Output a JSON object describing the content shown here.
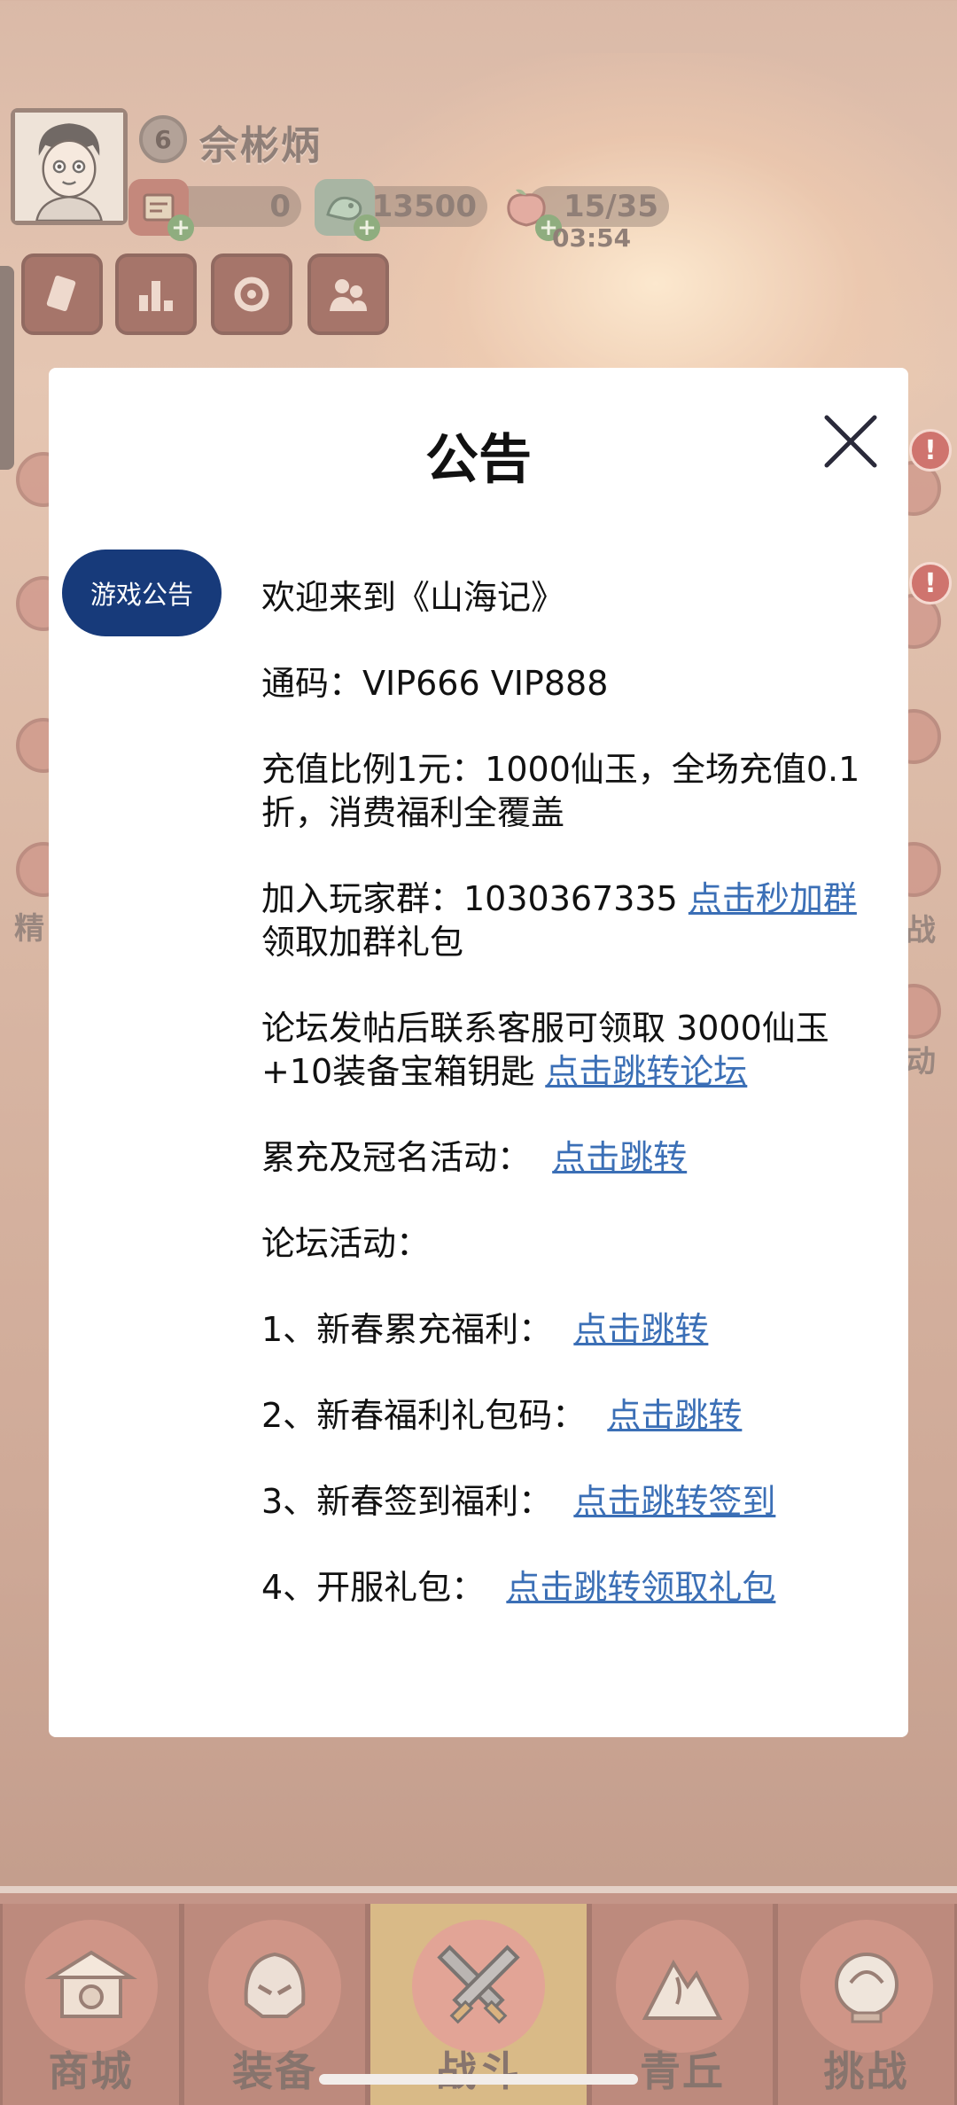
{
  "hud": {
    "level": "6",
    "player_name": "佘彬炳",
    "resources": [
      {
        "icon": "ticket-icon",
        "value": "0"
      },
      {
        "icon": "jade-dragon-icon",
        "value": "13500"
      },
      {
        "icon": "peach-icon",
        "value": "15/35"
      }
    ],
    "stamina_timer": "03:54"
  },
  "side_labels": {
    "left": "精",
    "right_1": "战",
    "right_2": "动"
  },
  "bottom_nav": [
    {
      "label": "商城",
      "icon": "shop-icon",
      "active": false
    },
    {
      "label": "装备",
      "icon": "helmet-icon",
      "active": false
    },
    {
      "label": "战斗",
      "icon": "crossed-swords-icon",
      "active": true
    },
    {
      "label": "青丘",
      "icon": "mountain-icon",
      "active": false
    },
    {
      "label": "挑战",
      "icon": "orb-icon",
      "active": false
    }
  ],
  "dialog": {
    "title": "公告",
    "tab": "游戏公告",
    "welcome": "欢迎来到《山海记》",
    "code": "通码：VIP666 VIP888",
    "recharge": "充值比例1元：1000仙玉，全场充值0.1折，消费福利全覆盖",
    "group_text": "加入玩家群：1030367335 ",
    "group_link": "点击秒加群",
    "group_suffix": " 领取加群礼包",
    "forum_text": "论坛发帖后联系客服可领取 3000仙玉+10装备宝箱钥匙 ",
    "forum_link": "点击跳转论坛",
    "cumulative_text": "累充及冠名活动：  ",
    "cumulative_link": "点击跳转",
    "forum_activity": "论坛活动：",
    "item1_text": "1、新春累充福利：  ",
    "item1_link": "点击跳转",
    "item2_text": "2、新春福利礼包码：  ",
    "item2_link": "点击跳转",
    "item3_text": "3、新春签到福利：  ",
    "item3_link": "点击跳转签到",
    "item4_text": "4、开服礼包：  ",
    "item4_link": "点击跳转领取礼包"
  }
}
